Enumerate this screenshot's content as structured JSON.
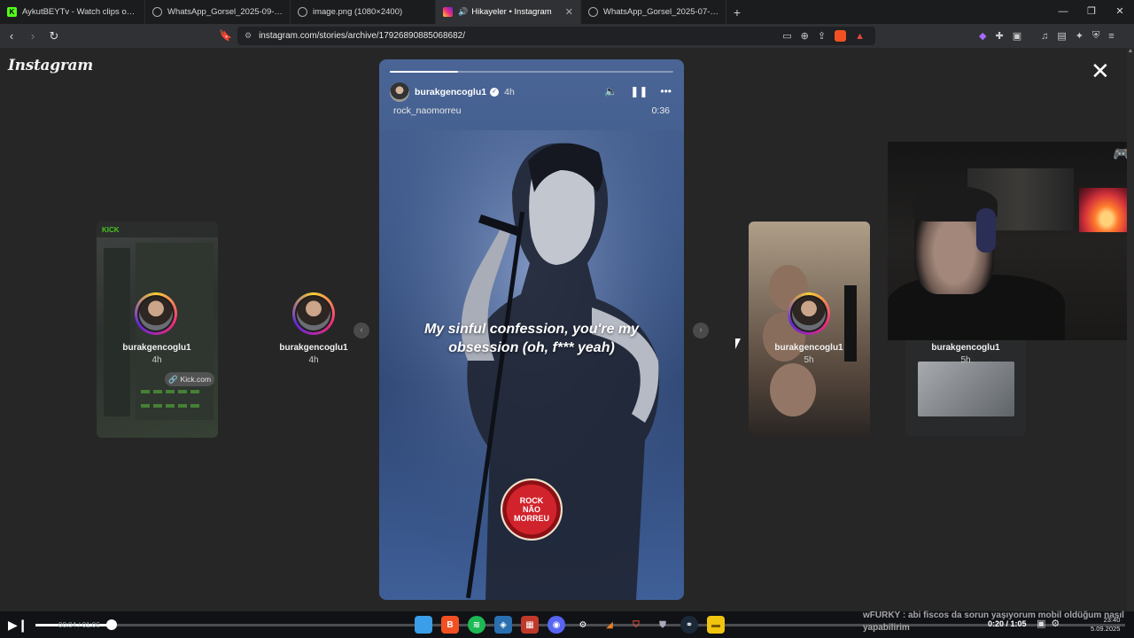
{
  "browser": {
    "tabs": [
      {
        "title": "AykutBEYTv - Watch clips on Kick",
        "favicon": "kick",
        "color": "#53fc18"
      },
      {
        "title": "WhatsApp_Gorsel_2025-09-05_saat_",
        "favicon": "globe",
        "color": "#888888"
      },
      {
        "title": "image.png (1080×2400)",
        "favicon": "globe",
        "color": "#888888"
      },
      {
        "title": "Hikayeler • Instagram",
        "favicon": "instagram",
        "color": "#e1306c",
        "active": true
      },
      {
        "title": "WhatsApp_Gorsel_2025-07-18_saat_",
        "favicon": "globe",
        "color": "#888888"
      }
    ],
    "new_tab": "+",
    "url": "instagram.com/stories/archive/17926890885068682/"
  },
  "instagram": {
    "logo": "Instagram",
    "close": "✕"
  },
  "side_stories": [
    {
      "user": "burakgencoglu1",
      "time": "4h",
      "badge": "Kick.com"
    },
    {
      "user": "burakgencoglu1",
      "time": "4h"
    },
    {
      "user": "burakgencoglu1",
      "time": "5h"
    },
    {
      "user": "burakgencoglu1",
      "time": "5h"
    }
  ],
  "story": {
    "user": "burakgencoglu1",
    "time": "4h",
    "subtitle": "rock_naomorreu",
    "duration": "0:36",
    "progress": 0.24,
    "lyrics": "My sinful confession, you're my obsession (oh, f*** yeah)",
    "logo_lines": [
      "ROCK",
      "NÃO",
      "MORREU"
    ]
  },
  "player": {
    "time": "00:04 / 01:06",
    "progress": 0.07,
    "clip_time": "0:20 / 1:05"
  },
  "chat": {
    "user": "wFURKY",
    "message": "abi fiscos da sorun yaşıyorum mobil oldüğum nasıl yapabilirim"
  },
  "clock": {
    "time": "23:40",
    "date": "5.09.2025"
  },
  "colors": {
    "page_bg": "#262626",
    "story_bg": "#3e5b8c",
    "instagram_ring": "#ee2a7b"
  }
}
